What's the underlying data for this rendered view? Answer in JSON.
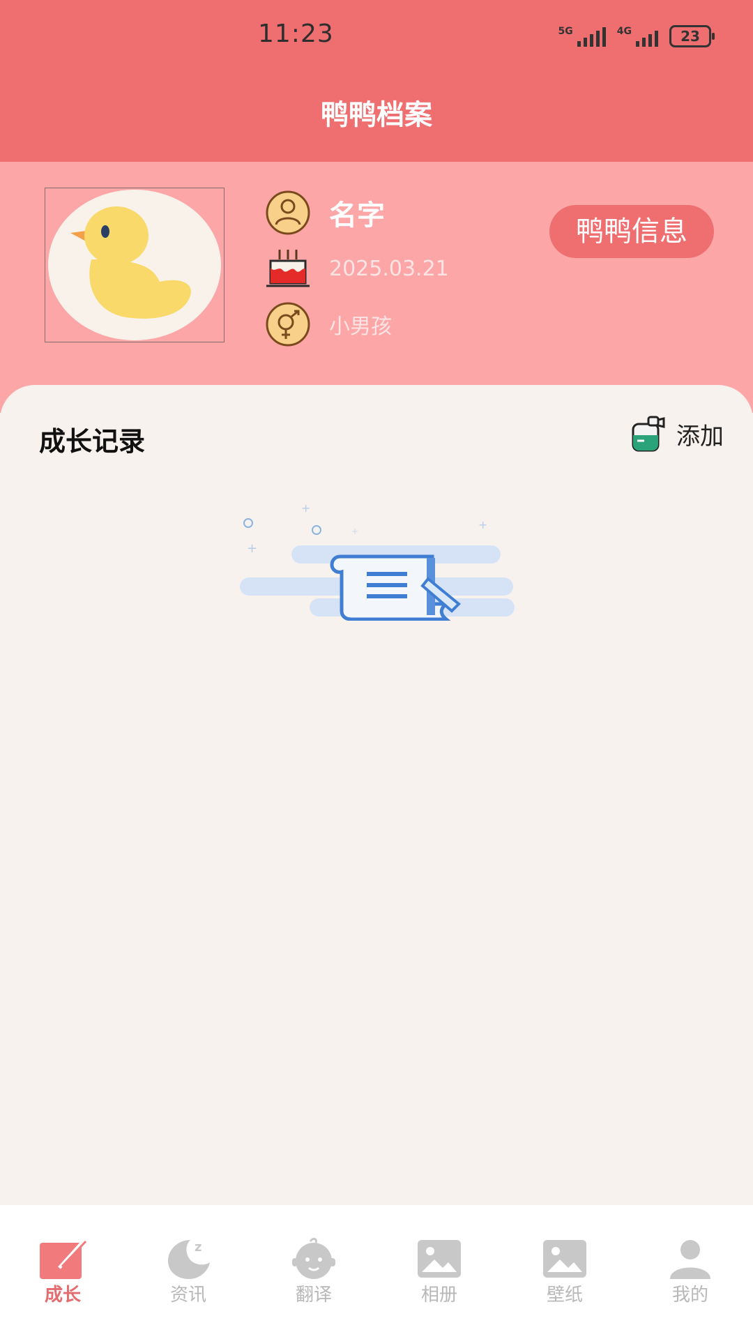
{
  "status_bar": {
    "time": "11:23",
    "signal1": "5G",
    "signal2": "4G",
    "battery": "23"
  },
  "header": {
    "title": "鸭鸭档案"
  },
  "profile": {
    "name": "名字",
    "birthday": "2025.03.21",
    "gender": "小男孩",
    "info_button": "鸭鸭信息"
  },
  "records": {
    "title": "成长记录",
    "add_label": "添加"
  },
  "tabs": [
    {
      "label": "成长",
      "icon": "growth-icon",
      "active": true
    },
    {
      "label": "资讯",
      "icon": "moon-icon",
      "active": false
    },
    {
      "label": "翻译",
      "icon": "baby-face-icon",
      "active": false
    },
    {
      "label": "相册",
      "icon": "photo-icon",
      "active": false
    },
    {
      "label": "壁纸",
      "icon": "image-icon",
      "active": false
    },
    {
      "label": "我的",
      "icon": "user-icon",
      "active": false
    }
  ],
  "colors": {
    "primary": "#ef6e70",
    "profile_bg": "#fca6a8",
    "page_bg": "#f8f2ee",
    "active_tab": "#e46b6e"
  }
}
